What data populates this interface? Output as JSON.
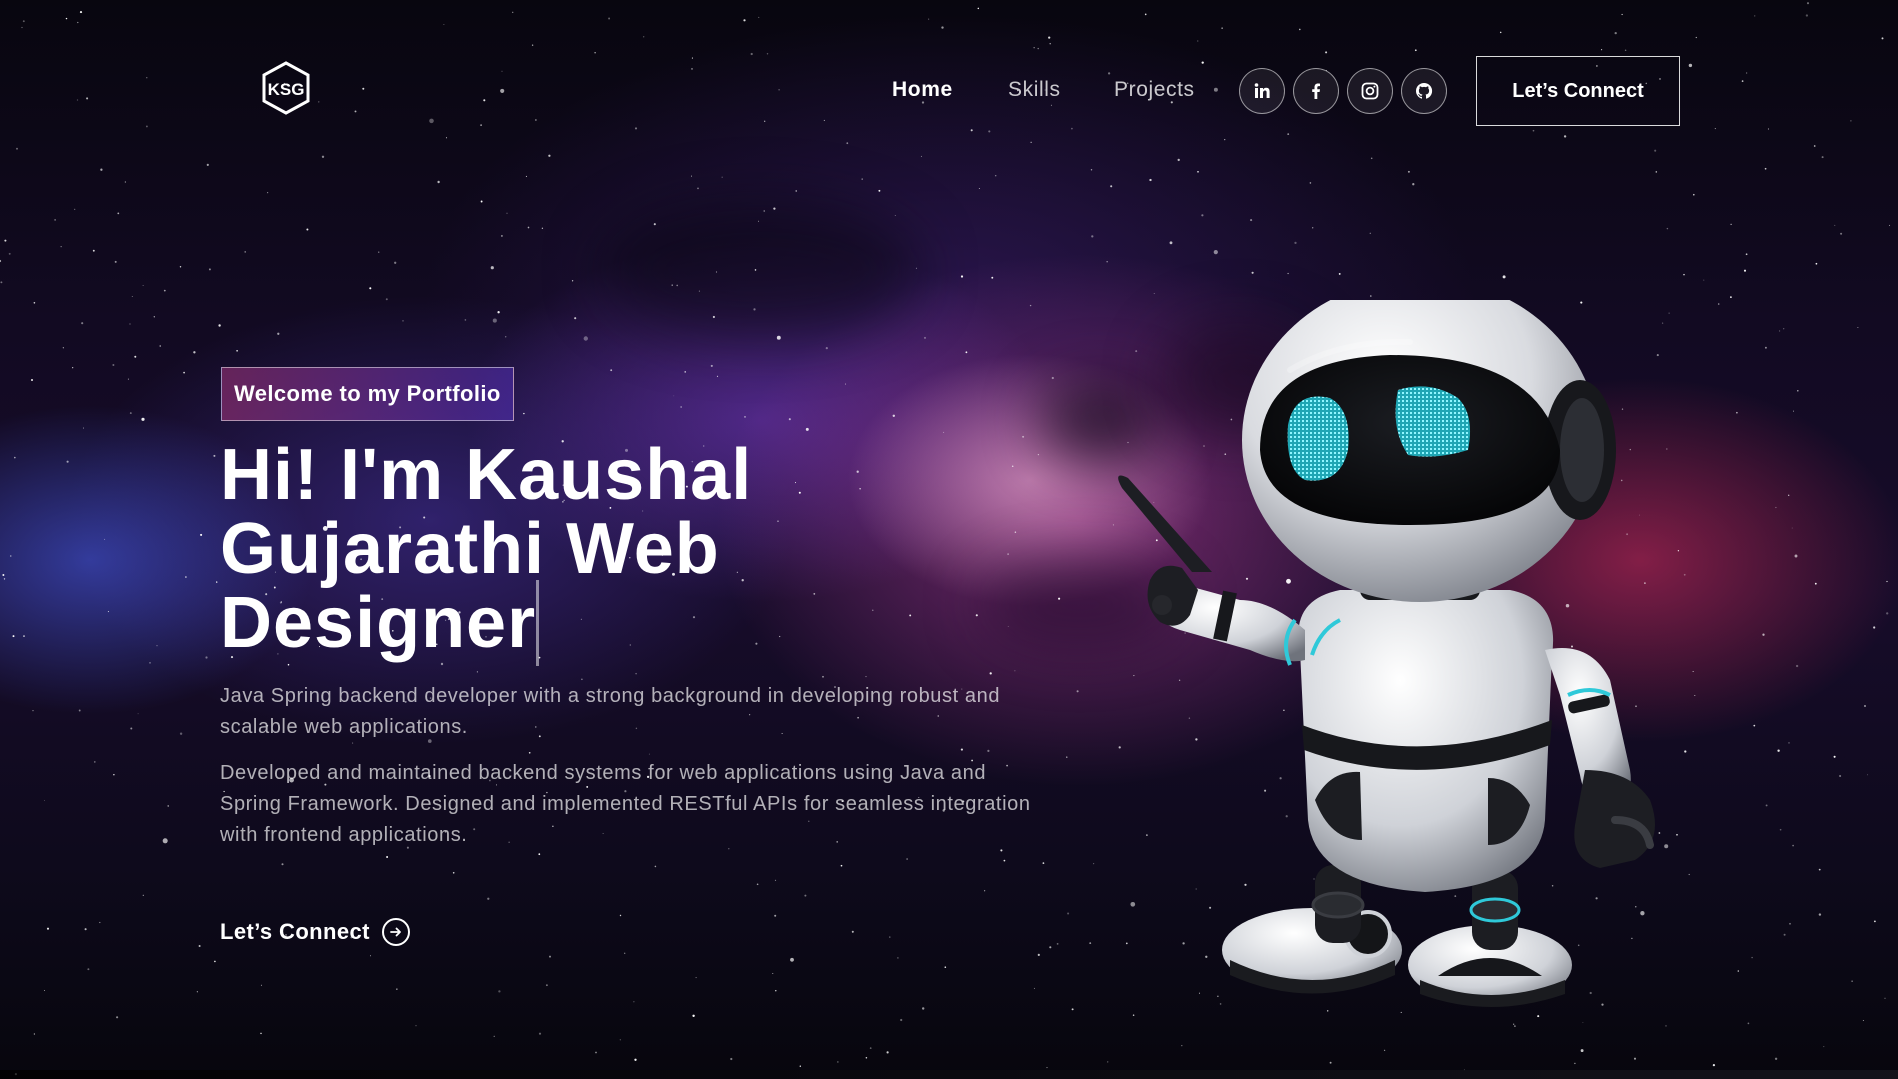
{
  "navbar": {
    "logo_text": "KSG",
    "links": [
      {
        "label": "Home",
        "active": true
      },
      {
        "label": "Skills",
        "active": false
      },
      {
        "label": "Projects",
        "active": false
      }
    ],
    "social": [
      "linkedin-icon",
      "facebook-icon",
      "instagram-icon",
      "github-icon"
    ],
    "connect_label": "Let’s Connect"
  },
  "hero": {
    "tagline": "Welcome to my Portfolio",
    "headline": "Hi! I'm Kaushal Gujarathi Web Designer",
    "paragraph_1": "Java Spring backend developer with a strong background in developing robust and scalable web applications.",
    "paragraph_2": "Developed and maintained backend systems for web applications using Java and Spring Framework. Designed and implemented RESTful APIs for seamless integration with frontend applications.",
    "cta_label": "Let’s Connect"
  },
  "colors": {
    "tagline_gradient_start": "#aa367c",
    "tagline_gradient_end": "#4a2fbd",
    "robot_eye": "#2fc9d9"
  }
}
